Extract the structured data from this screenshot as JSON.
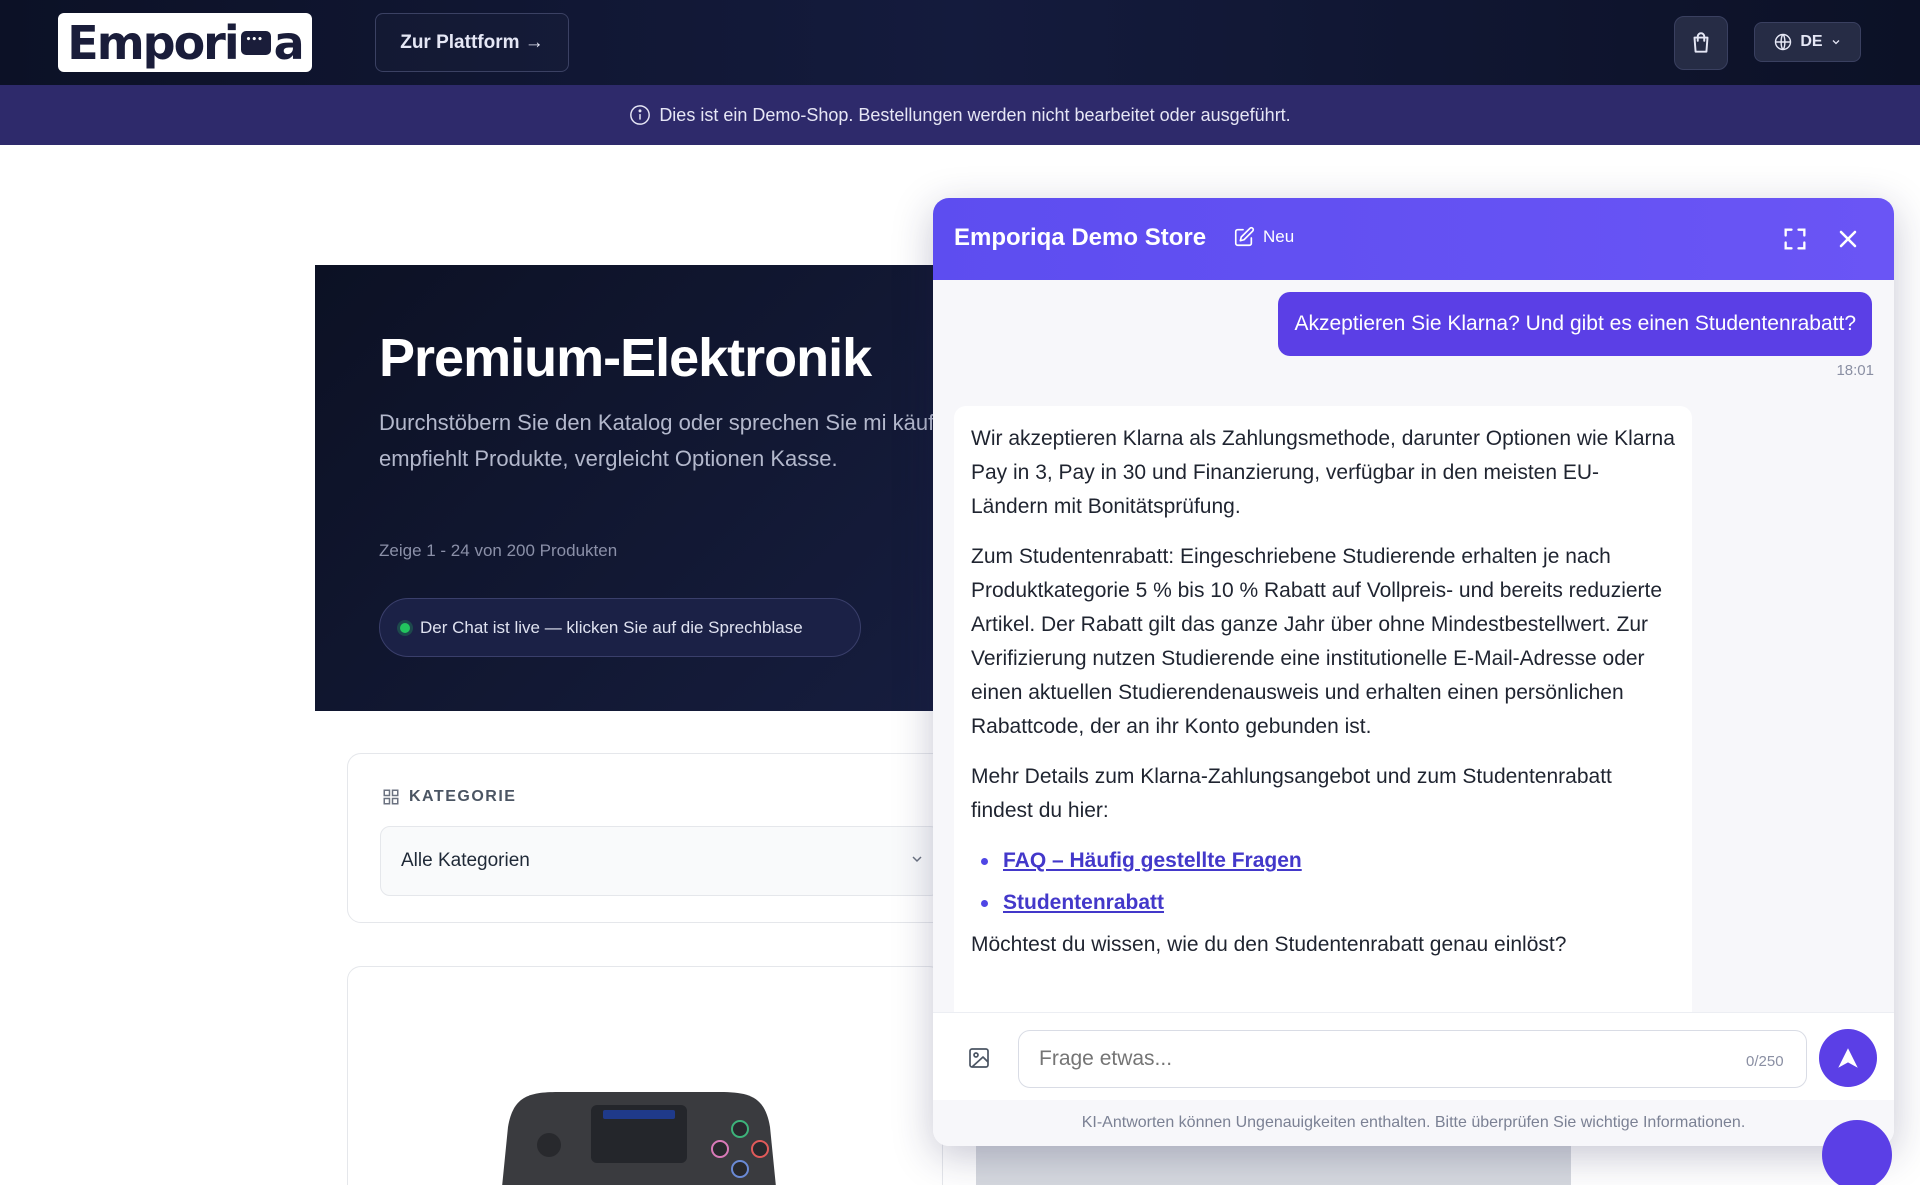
{
  "header": {
    "logo_text_a": "Empori",
    "logo_text_b": "a",
    "platform_button": "Zur Plattform →",
    "language": "DE"
  },
  "notice": {
    "text": "Dies ist ein Demo-Shop. Bestellungen werden nicht bearbeitet oder ausgeführt."
  },
  "hero": {
    "title": "Premium-Elektronik",
    "description": "Durchstöbern Sie den Katalog oder sprechen Sie mi käufer — er empfiehlt Produkte, vergleicht Optionen Kasse.",
    "count": "Zeige 1 - 24 von 200 Produkten",
    "live_badge": "Der Chat ist live — klicken Sie auf die Sprechblase"
  },
  "filter": {
    "label": "KATEGORIE",
    "selected": "Alle Kategorien"
  },
  "chat": {
    "title": "Emporiqa Demo Store",
    "new_label": "Neu",
    "user_message": "Akzeptieren Sie Klarna? Und gibt es einen Studentenrabatt?",
    "time": "18:01",
    "bot_para1": "Wir akzeptieren Klarna als Zahlungsmethode, darunter Optionen wie Klarna Pay in 3, Pay in 30 und Finanzierung, verfügbar in den meisten EU-Ländern mit Bonitätsprüfung.",
    "bot_para2": "Zum Studentenrabatt: Eingeschriebene Studierende erhalten je nach Produktkategorie 5 % bis 10 % Rabatt auf Vollpreis- und bereits reduzierte Artikel. Der Rabatt gilt das ganze Jahr über ohne Mindestbestellwert. Zur Verifizierung nutzen Studierende eine institutionelle E-Mail-Adresse oder einen aktuellen Studierendenausweis und erhalten einen persönlichen Rabattcode, der an ihr Konto gebunden ist.",
    "bot_para3": "Mehr Details zum Klarna-Zahlungsangebot und zum Studentenrabatt findest du hier:",
    "links": [
      "FAQ – Häufig gestellte Fragen",
      "Studentenrabatt"
    ],
    "bot_para4": "Möchtest du wissen, wie du den Studentenrabatt genau einlöst?",
    "input_placeholder": "Frage etwas...",
    "char_count": "0/250",
    "disclaimer": "KI-Antworten können Ungenauigkeiten enthalten. Bitte überprüfen Sie wichtige Informationen."
  },
  "colors": {
    "accent": "#5b3fe6",
    "topbar": "#0c1126",
    "notice": "#2e2a6b",
    "live": "#22c55e"
  },
  "icons": [
    "cart-icon",
    "globe-icon",
    "chevron-down-icon",
    "info-icon",
    "grid-icon",
    "edit-icon",
    "expand-icon",
    "close-icon",
    "image-icon",
    "send-icon"
  ]
}
